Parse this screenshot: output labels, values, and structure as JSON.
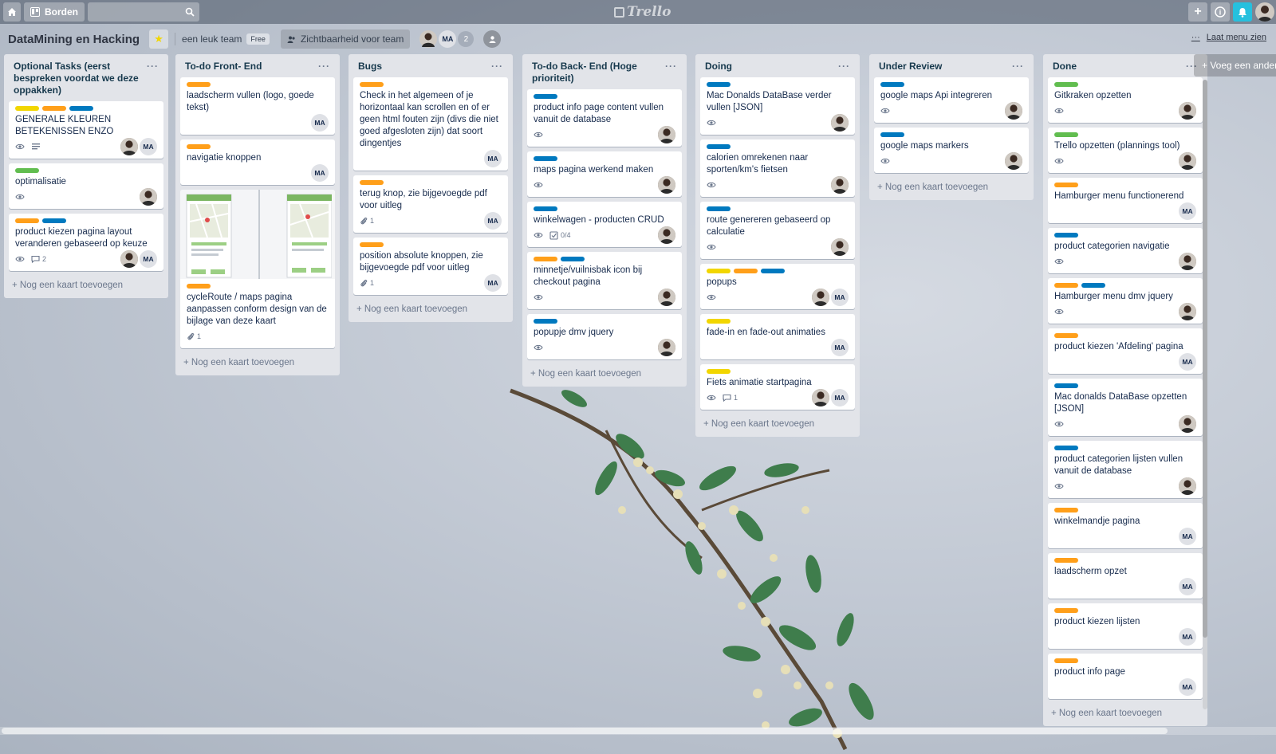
{
  "topbar": {
    "boards_label": "Borden",
    "logo_text": "Trello",
    "plus_label": "+",
    "info_label": "i"
  },
  "board": {
    "title": "DataMining en Hacking",
    "team": "een leuk team",
    "team_badge": "Free",
    "visibility": "Zichtbaarheid voor team",
    "member_initials": "MA",
    "member_count": "2",
    "menu_dots": "···",
    "menu_label": "Laat menu zien",
    "add_list": "+ Voeg een andere lijst toe"
  },
  "add_card_label": "+ Nog een kaart toevoegen",
  "colors": {
    "yellow": "#f2d600",
    "orange": "#ff9f1a",
    "blue": "#0079bf",
    "green": "#61bd4f"
  },
  "lists": [
    {
      "title": "Optional Tasks (eerst bespreken voordat we deze oppakken)",
      "cards": [
        {
          "labels": [
            "yellow",
            "orange",
            "blue"
          ],
          "title": "GENERALE KLEUREN BETEKENISSEN ENZO",
          "badges": {
            "watch": true,
            "desc": true
          },
          "members": [
            "photo",
            "MA"
          ]
        },
        {
          "labels": [
            "green"
          ],
          "title": "optimalisatie",
          "badges": {
            "watch": true
          },
          "members": [
            "photo"
          ]
        },
        {
          "labels": [
            "orange",
            "blue"
          ],
          "title": "product kiezen pagina layout veranderen gebaseerd op keuze",
          "badges": {
            "watch": true,
            "comments": "2"
          },
          "members": [
            "photo",
            "MA"
          ]
        }
      ]
    },
    {
      "title": "To-do Front- End",
      "cards": [
        {
          "labels": [
            "orange"
          ],
          "title": "laadscherm vullen (logo, goede tekst)",
          "badges": {},
          "members": [
            "MA"
          ]
        },
        {
          "labels": [
            "orange"
          ],
          "title": "navigatie knoppen",
          "badges": {},
          "members": [
            "MA"
          ]
        },
        {
          "labels": [
            "orange"
          ],
          "title": "cycleRoute / maps pagina aanpassen conform design van de bijlage van deze kaart",
          "cover": true,
          "badges": {
            "attachments": "1"
          },
          "members": []
        }
      ]
    },
    {
      "title": "Bugs",
      "cards": [
        {
          "labels": [
            "orange"
          ],
          "title": "Check in het algemeen of je horizontaal kan scrollen en of er geen html fouten zijn (divs die niet goed afgesloten zijn) dat soort dingentjes",
          "badges": {},
          "members": [
            "MA"
          ]
        },
        {
          "labels": [
            "orange"
          ],
          "title": "terug knop, zie bijgevoegde pdf voor uitleg",
          "badges": {
            "attachments": "1"
          },
          "members": [
            "MA"
          ]
        },
        {
          "labels": [
            "orange"
          ],
          "title": "position absolute knoppen, zie bijgevoegde pdf voor uitleg",
          "badges": {
            "attachments": "1"
          },
          "members": [
            "MA"
          ]
        }
      ]
    },
    {
      "title": "To-do Back- End (Hoge prioriteit)",
      "cards": [
        {
          "labels": [
            "blue"
          ],
          "title": "product info page content vullen vanuit de database",
          "badges": {
            "watch": true
          },
          "members": [
            "photo"
          ]
        },
        {
          "labels": [
            "blue"
          ],
          "title": "maps pagina werkend maken",
          "badges": {
            "watch": true
          },
          "members": [
            "photo"
          ]
        },
        {
          "labels": [
            "blue"
          ],
          "title": "winkelwagen - producten CRUD",
          "badges": {
            "watch": true,
            "checklist": "0/4"
          },
          "members": [
            "photo"
          ]
        },
        {
          "labels": [
            "orange",
            "blue"
          ],
          "title": "minnetje/vuilnisbak icon bij checkout pagina",
          "badges": {
            "watch": true
          },
          "members": [
            "photo"
          ]
        },
        {
          "labels": [
            "blue"
          ],
          "title": "popupje dmv jquery",
          "badges": {
            "watch": true
          },
          "members": [
            "photo"
          ]
        }
      ]
    },
    {
      "title": "Doing",
      "cards": [
        {
          "labels": [
            "blue"
          ],
          "title": "Mac Donalds DataBase verder vullen [JSON]",
          "badges": {
            "watch": true
          },
          "members": [
            "photo"
          ]
        },
        {
          "labels": [
            "blue"
          ],
          "title": "calorien omrekenen naar sporten/km's fietsen",
          "badges": {
            "watch": true
          },
          "members": [
            "photo"
          ]
        },
        {
          "labels": [
            "blue"
          ],
          "title": "route genereren gebaseerd op calculatie",
          "badges": {
            "watch": true
          },
          "members": [
            "photo"
          ]
        },
        {
          "labels": [
            "yellow",
            "orange",
            "blue"
          ],
          "title": "popups",
          "badges": {
            "watch": true
          },
          "members": [
            "photo",
            "MA"
          ]
        },
        {
          "labels": [
            "yellow"
          ],
          "title": "fade-in en fade-out animaties",
          "badges": {},
          "members": [
            "MA"
          ]
        },
        {
          "labels": [
            "yellow"
          ],
          "title": "Fiets animatie startpagina",
          "badges": {
            "watch": true,
            "comments": "1"
          },
          "members": [
            "photo",
            "MA"
          ]
        }
      ]
    },
    {
      "title": "Under Review",
      "cards": [
        {
          "labels": [
            "blue"
          ],
          "title": "google maps Api integreren",
          "badges": {
            "watch": true
          },
          "members": [
            "photo"
          ]
        },
        {
          "labels": [
            "blue"
          ],
          "title": "google maps markers",
          "badges": {
            "watch": true
          },
          "members": [
            "photo"
          ]
        }
      ]
    },
    {
      "title": "Done",
      "cards": [
        {
          "labels": [
            "green"
          ],
          "title": "Gitkraken opzetten",
          "badges": {
            "watch": true
          },
          "members": [
            "photo"
          ]
        },
        {
          "labels": [
            "green"
          ],
          "title": "Trello opzetten (plannings tool)",
          "badges": {
            "watch": true
          },
          "members": [
            "photo"
          ]
        },
        {
          "labels": [
            "orange"
          ],
          "title": "Hamburger menu functionerend",
          "badges": {},
          "members": [
            "MA"
          ]
        },
        {
          "labels": [
            "blue"
          ],
          "title": "product categorien navigatie",
          "badges": {
            "watch": true
          },
          "members": [
            "photo"
          ]
        },
        {
          "labels": [
            "orange",
            "blue"
          ],
          "title": "Hamburger menu dmv jquery",
          "badges": {
            "watch": true
          },
          "members": [
            "photo"
          ]
        },
        {
          "labels": [
            "orange"
          ],
          "title": "product kiezen 'Afdeling' pagina",
          "badges": {},
          "members": [
            "MA"
          ]
        },
        {
          "labels": [
            "blue"
          ],
          "title": "Mac donalds DataBase opzetten [JSON]",
          "badges": {
            "watch": true
          },
          "members": [
            "photo"
          ]
        },
        {
          "labels": [
            "blue"
          ],
          "title": "product categorien lijsten vullen vanuit de database",
          "badges": {
            "watch": true
          },
          "members": [
            "photo"
          ]
        },
        {
          "labels": [
            "orange"
          ],
          "title": "winkelmandje pagina",
          "badges": {},
          "members": [
            "MA"
          ]
        },
        {
          "labels": [
            "orange"
          ],
          "title": "laadscherm opzet",
          "badges": {},
          "members": [
            "MA"
          ]
        },
        {
          "labels": [
            "orange"
          ],
          "title": "product kiezen lijsten",
          "badges": {},
          "members": [
            "MA"
          ]
        },
        {
          "labels": [
            "orange"
          ],
          "title": "product info page",
          "badges": {},
          "members": [
            "MA"
          ]
        }
      ]
    }
  ]
}
